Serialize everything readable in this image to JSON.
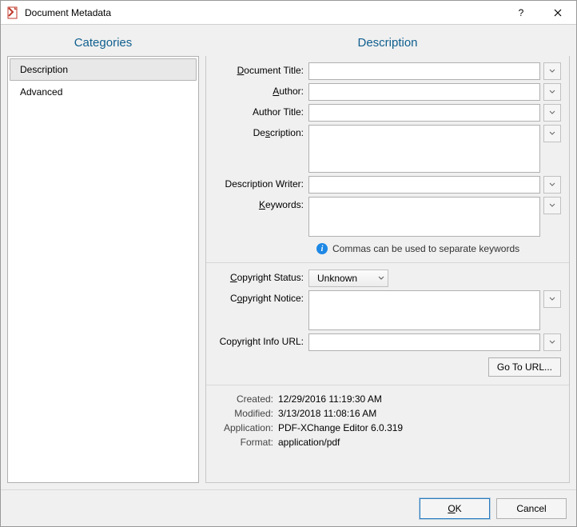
{
  "titlebar": {
    "title": "Document Metadata"
  },
  "panels": {
    "categories_header": "Categories",
    "description_header": "Description"
  },
  "categories": {
    "items": [
      "Description",
      "Advanced"
    ],
    "selected": 0
  },
  "labels": {
    "doc_title_pre": "",
    "doc_title_mn": "D",
    "doc_title_post": "ocument Title:",
    "author_pre": "",
    "author_mn": "A",
    "author_post": "uthor:",
    "author_title": "Author Title:",
    "description_pre": "De",
    "description_mn": "s",
    "description_post": "cription:",
    "desc_writer": "Description Writer:",
    "keywords_pre": "",
    "keywords_mn": "K",
    "keywords_post": "eywords:",
    "copyright_status_pre": "",
    "copyright_status_mn": "C",
    "copyright_status_post": "opyright Status:",
    "copyright_notice_pre": "C",
    "copyright_notice_mn": "o",
    "copyright_notice_post": "pyright Notice:",
    "copyright_url": "Copyright Info URL:"
  },
  "values": {
    "doc_title": "",
    "author": "",
    "author_title": "",
    "description": "",
    "desc_writer": "",
    "keywords": "",
    "copyright_status": "Unknown",
    "copyright_notice": "",
    "copyright_url": ""
  },
  "hint": "Commas can be used to separate keywords",
  "buttons": {
    "goto_url": "Go To URL...",
    "ok": "OK",
    "cancel": "Cancel"
  },
  "info": {
    "created_label": "Created:",
    "created_value": "12/29/2016 11:19:30 AM",
    "modified_label": "Modified:",
    "modified_value": "3/13/2018 11:08:16 AM",
    "application_label": "Application:",
    "application_value": "PDF-XChange Editor 6.0.319",
    "format_label": "Format:",
    "format_value": "application/pdf"
  }
}
